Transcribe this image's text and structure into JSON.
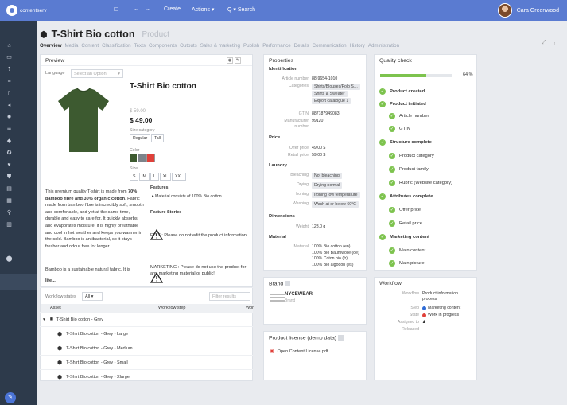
{
  "app": {
    "logo_text": "contentserv",
    "toolbar": {
      "create": "Create",
      "actions": "Actions ▾",
      "search": "Q ▾ Search"
    },
    "user_name": "Cara Greenwood"
  },
  "header": {
    "title": "T-Shirt Bio cotton",
    "type": "Product",
    "tabs": [
      "Overview",
      "Media",
      "Content",
      "Classification",
      "Texts",
      "Components",
      "Outputs",
      "Sales & marketing",
      "Publish",
      "Performance",
      "Details",
      "Communication",
      "History",
      "Administration"
    ],
    "active_tab": 0
  },
  "preview": {
    "title": "Preview",
    "language_label": "Language",
    "language_placeholder": "Select an Option",
    "product_name": "T-Shirt Bio cotton",
    "old_price": "$ 59.00",
    "price": "$ 49.00",
    "size_category_label": "Size category",
    "size_categories": [
      "Regular",
      "Tall"
    ],
    "color_label": "Color",
    "colors": [
      "#3d5a30",
      "#7d838a",
      "#e0403a"
    ],
    "size_label": "Size",
    "sizes": [
      "S",
      "M",
      "L",
      "XL",
      "XXL"
    ],
    "description_1_pre": "This premium quality T-shirt is made from ",
    "description_1_bold": "70% bamboo fibre and 30% organic cotton",
    "description_1_post": ". Fabric made from bamboo fibre is incredibly soft, smooth and comfortable, and yet at the same time, durable and easy to care for. It quickly absorbs and evaporates moisture; it is highly breathable and cool in hot weather and keeps you warmer in the cold. Bamboo is antibacterial, so it stays fresher and odour free for longer.",
    "description_2": "Bamboo is a sustainable natural fabric. It is",
    "more": "lite...",
    "features_label": "Features",
    "feature_1": "Material consists of 100% Bio cotton",
    "feature_stories_label": "Feature Stories",
    "story_1": "EDIT : Please do not edit the product information!",
    "story_2": "MARKETING : Please do not use the product for any marketing material or public!"
  },
  "workflow_table": {
    "states_label": "Workflow states",
    "states_value": "All",
    "filter_placeholder": "Filter results",
    "col_asset": "Asset",
    "col_step": "Workflow step",
    "col_wor": "Wor",
    "group": "T-Shirt Bio cotton - Grey",
    "rows": [
      "T-Shirt Bio cotton - Grey - Large",
      "T-Shirt Bio cotton - Grey - Medium",
      "T-Shirt Bio cotton - Grey - Small",
      "T-Shirt Bio cotton - Grey - Xlarge"
    ]
  },
  "properties": {
    "title": "Properties",
    "identification": "Identification",
    "article_number_label": "Article number",
    "article_number": "88-9654-1010",
    "categories_label": "Categories",
    "categories": [
      "Shirts/Blouses/Polo S…",
      "Shirts & Sweater",
      "Export catalogue 1"
    ],
    "gtin_label": "GTIN",
    "gtin": "887187949083",
    "manufacturer_label": "Manufacturer number",
    "manufacturer": "99120",
    "price": "Price",
    "offer_price_label": "Offer price",
    "offer_price": "49.00 $",
    "retail_price_label": "Retail price",
    "retail_price": "59.00 $",
    "laundry": "Laundry",
    "bleaching_label": "Bleaching",
    "bleaching": "Not bleaching",
    "drying_label": "Drying",
    "drying": "Drying normal",
    "ironing_label": "Ironing",
    "ironing": "Ironing low temperature",
    "washing_label": "Washing",
    "washing": "Wash at or below 60°C",
    "dimensions": "Dimensions",
    "weight_label": "Weight",
    "weight": "128.0 g",
    "material": "Material",
    "material_label": "Material",
    "materials": [
      "100% Bio cotton (en)",
      "100% Bio Baumwolle (de)",
      "100% Coton bio (fr)",
      "100% Bio algodón (es)"
    ]
  },
  "quality": {
    "title": "Quality check",
    "progress": 64,
    "progress_label": "64 %",
    "items": [
      {
        "label": "Product created",
        "level": 0
      },
      {
        "label": "Product initiated",
        "level": 0
      },
      {
        "label": "Article number",
        "level": 1
      },
      {
        "label": "GTIN",
        "level": 1
      },
      {
        "label": "Structure complete",
        "level": 0
      },
      {
        "label": "Product category",
        "level": 1
      },
      {
        "label": "Product family",
        "level": 1
      },
      {
        "label": "Rubric (Website category)",
        "level": 1
      },
      {
        "label": "Attributes complete",
        "level": 0
      },
      {
        "label": "Offer price",
        "level": 1
      },
      {
        "label": "Retail price",
        "level": 1
      },
      {
        "label": "Marketing content",
        "level": 0
      },
      {
        "label": "Main content",
        "level": 1
      },
      {
        "label": "Main picture",
        "level": 1
      }
    ]
  },
  "brand": {
    "title": "Brand",
    "name": "NYCEWEAR",
    "sub": "Brand"
  },
  "license": {
    "title": "Product license (demo data)",
    "file": "Open Content License.pdf"
  },
  "workflow": {
    "title": "Workflow",
    "workflow_label": "Workflow",
    "workflow_value": "Product information process",
    "step_label": "Step",
    "step_value": "Marketing content",
    "state_label": "State",
    "state_value": "Work in progress",
    "assigned_label": "Assigned to",
    "released_label": "Released",
    "step_color": "#2e6bd6",
    "state_color": "#e0403a"
  }
}
